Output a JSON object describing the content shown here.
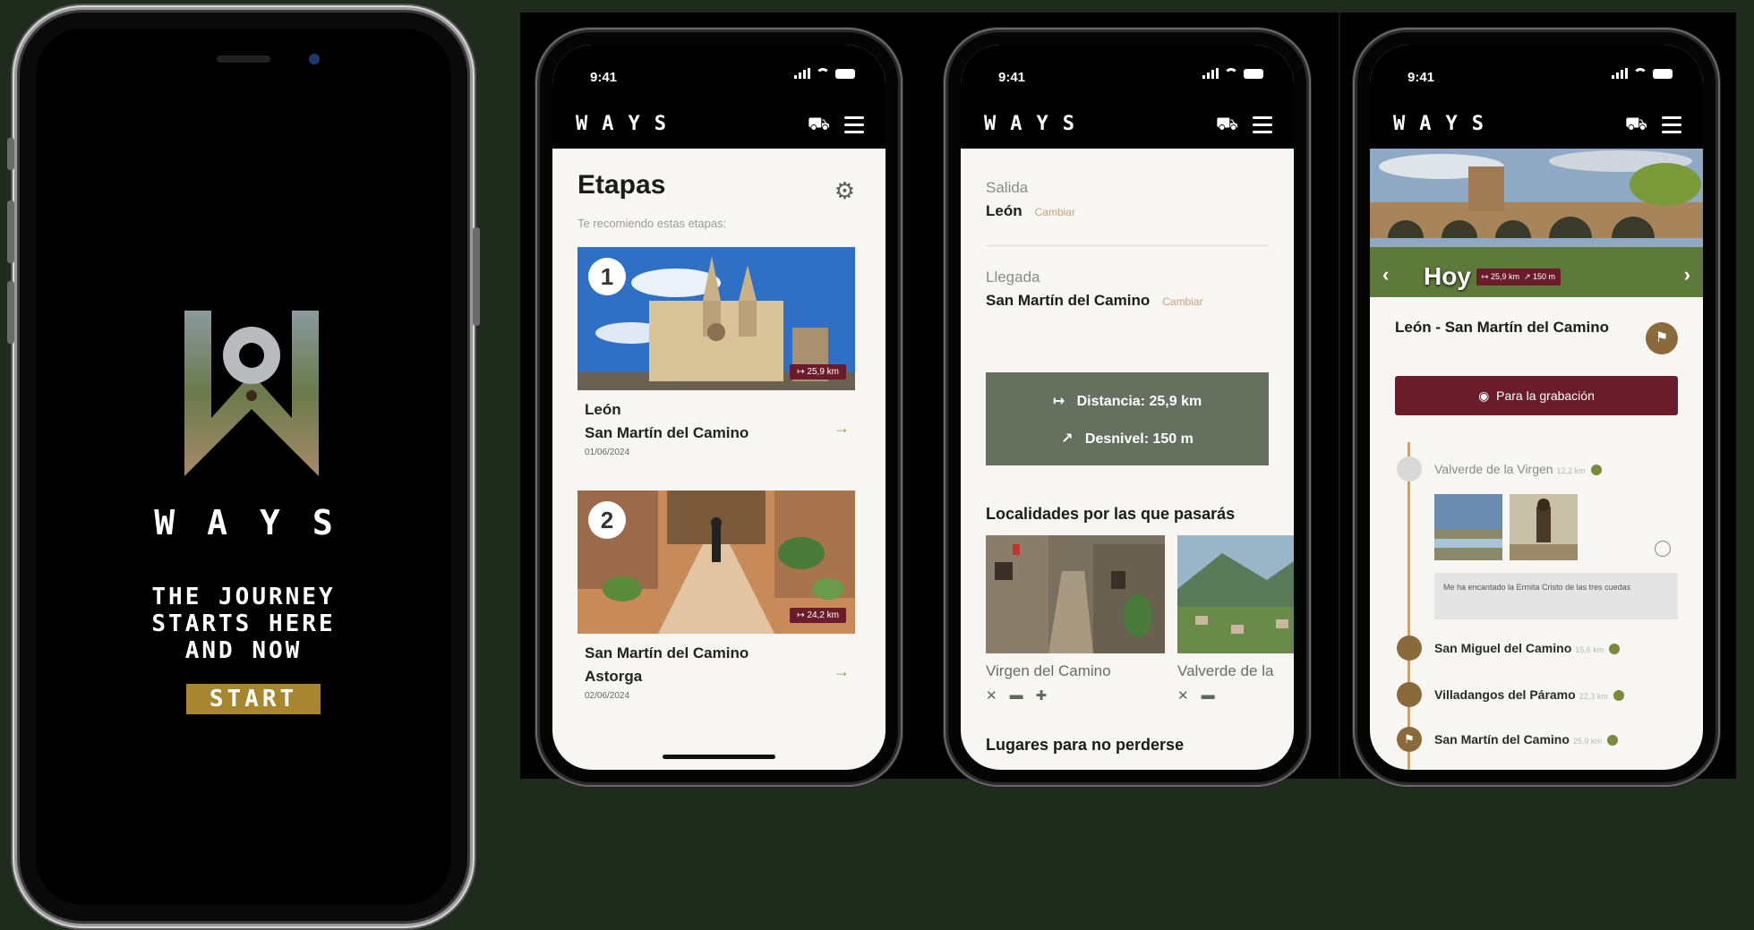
{
  "splash": {
    "brand": "WAYS",
    "tagline": "THE JOURNEY\nSTARTS HERE\nAND NOW",
    "start_label": "START"
  },
  "status": {
    "time": "9:41"
  },
  "appbar": {
    "brand": "WAYS"
  },
  "stages_screen": {
    "title": "Etapas",
    "subtitle": "Te recomiendo estas etapas:",
    "stages": [
      {
        "number": "1",
        "from": "León",
        "to": "San Martín del Camino",
        "date": "01/06/2024",
        "km": "25,9 km"
      },
      {
        "number": "2",
        "from": "San Martín del Camino",
        "to": "Astorga",
        "date": "02/06/2024",
        "km": "24,2 km"
      }
    ]
  },
  "route_screen": {
    "departure_label": "Salida",
    "departure_value": "León",
    "change_label": "Cambiar",
    "arrival_label": "Llegada",
    "arrival_value": "San Martín del Camino",
    "distance": "Distancia: 25,9 km",
    "elevation": "Desnivel: 150 m",
    "towns_title": "Localidades por las que pasarás",
    "towns": [
      "Virgen del Camino",
      "Valverde de la"
    ],
    "places_title": "Lugares para no perderse"
  },
  "today_screen": {
    "today_label": "Hoy",
    "chip_distance": "25,9 km",
    "chip_elevation": "150 m",
    "route_title": "León - San Martín del Camino",
    "record_label": "Para la grabación",
    "comment": "Me ha encantado la Ermita Cristo de las tres cuedas",
    "stops": [
      {
        "name": "Valverde de la Virgen",
        "dist": "12,2 km"
      },
      {
        "name": "San Miguel del Camino",
        "dist": "15,6 km"
      },
      {
        "name": "Villadangos del Páramo",
        "dist": "22,3 km"
      },
      {
        "name": "San Martín del Camino",
        "dist": "25,9 km"
      }
    ]
  },
  "colors": {
    "background": "#1f2b1c",
    "accent_gold": "#a8862f",
    "burgundy": "#6b1c2a",
    "sage": "#65705e"
  }
}
